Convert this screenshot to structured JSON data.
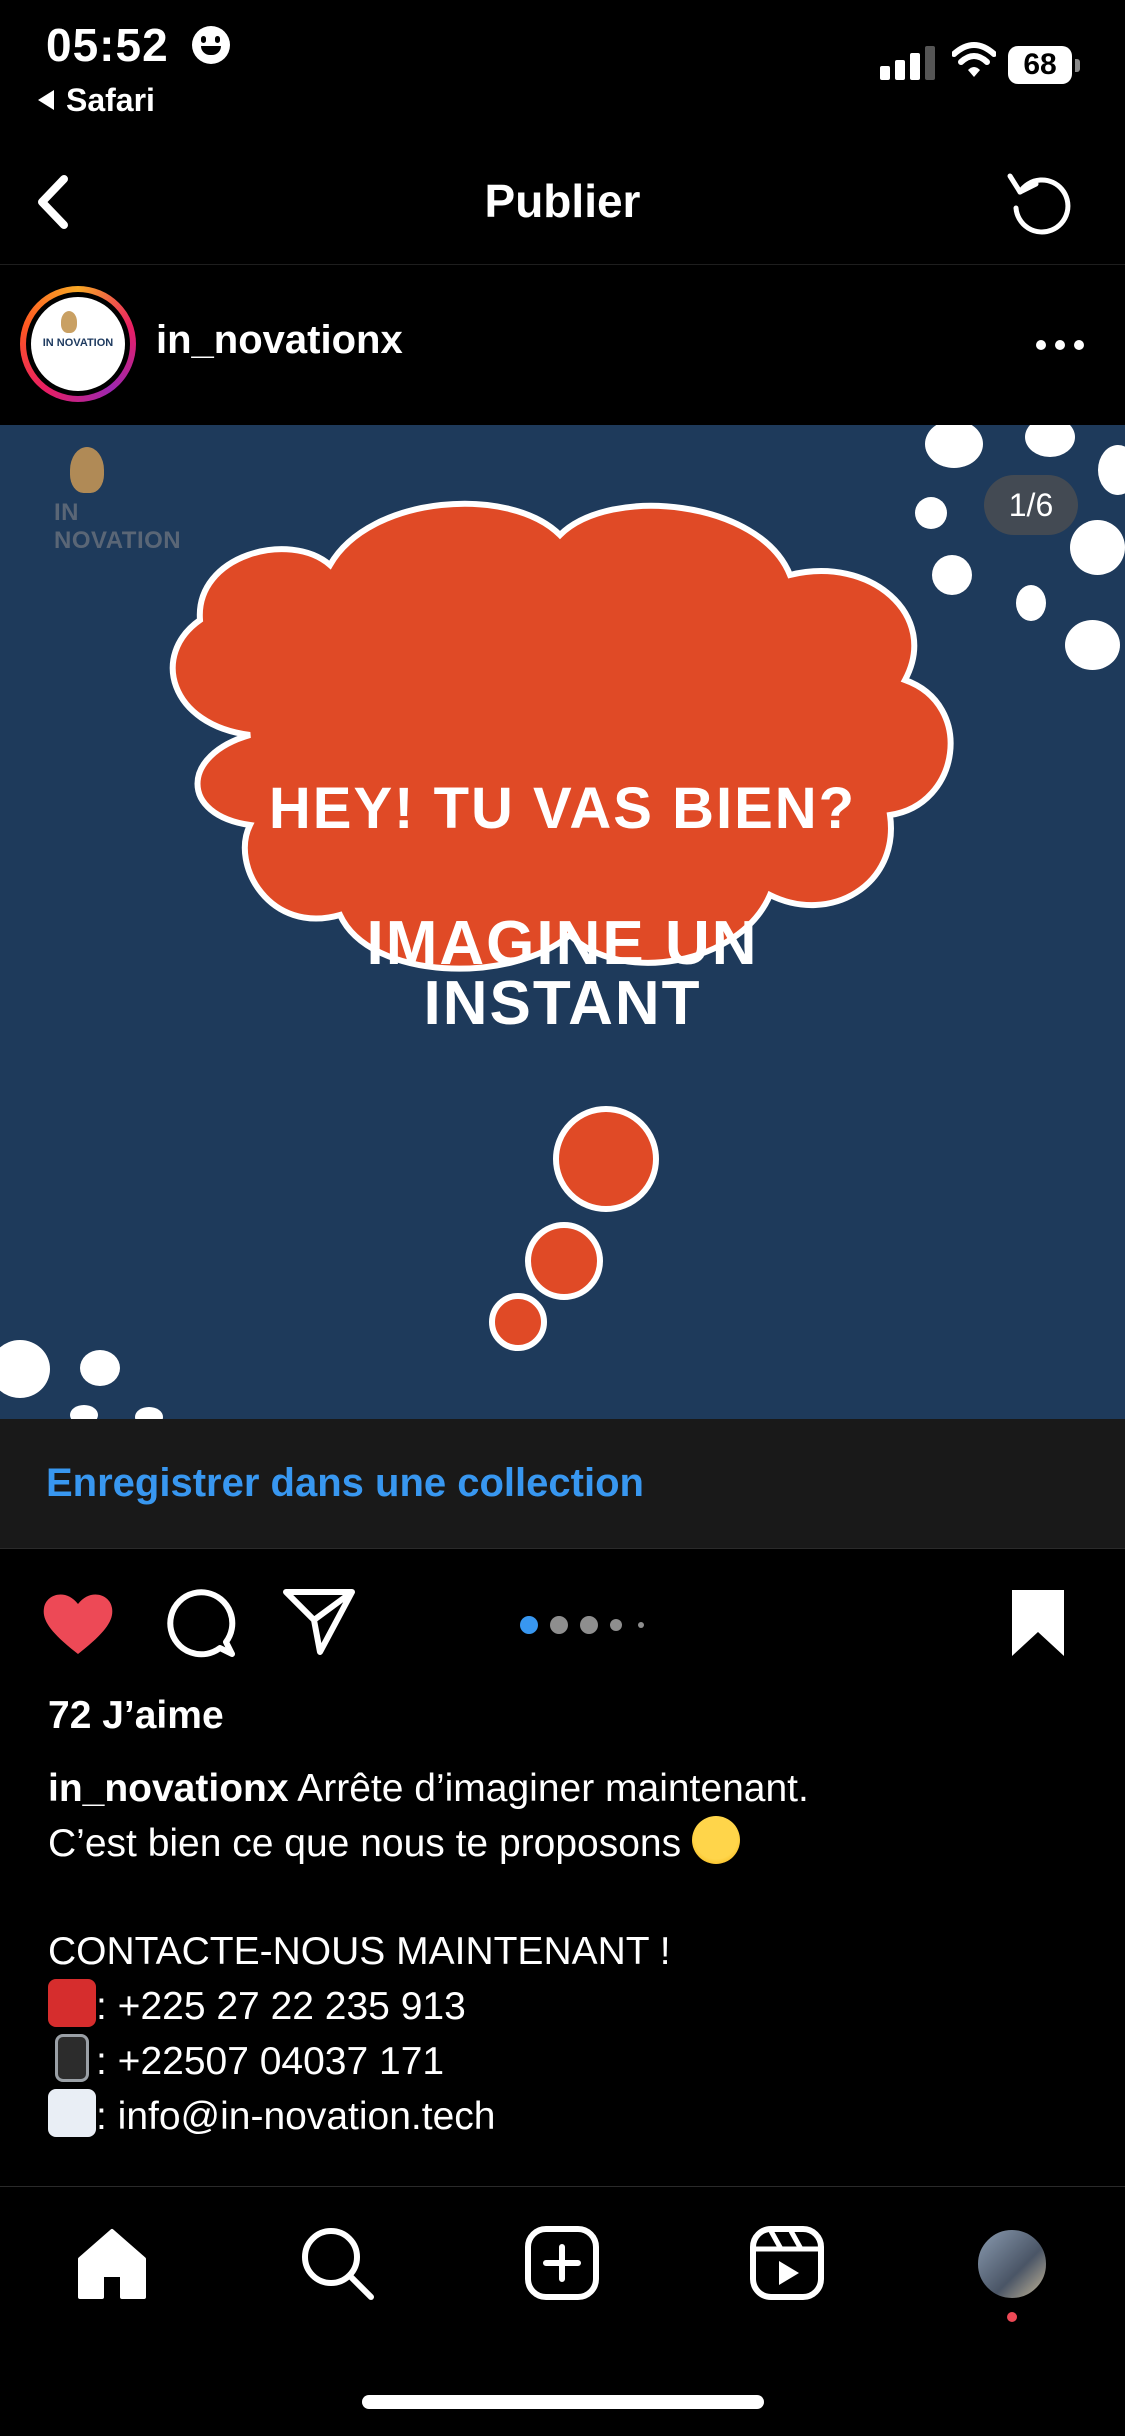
{
  "status_bar": {
    "time": "05:52",
    "back_app": "Safari",
    "battery": "68"
  },
  "header": {
    "title": "Publier"
  },
  "post": {
    "username": "in_novationx",
    "image": {
      "brand": "IN NOVATION",
      "page_indicator": "1/6",
      "line1": "HEY! TU VAS BIEN?",
      "line2": "IMAGINE UN",
      "line3": "INSTANT",
      "colors": {
        "background": "#1e3a5b",
        "cloud": "#e04a26",
        "blobs": "#ffffff"
      }
    },
    "save_collection": "Enregistrer dans une collection",
    "carousel": {
      "current": 1,
      "total": 6
    },
    "likes": "72 J’aime",
    "caption": {
      "username": "in_novationx",
      "line1": "Arrête d’imaginer maintenant.",
      "line2": "C’est bien ce que nous te proposons",
      "contact_heading": "CONTACTE-NOUS MAINTENANT !",
      "phone_fixed": ": +225 27 22 235 913",
      "phone_mobile": ": +22507 04037 171",
      "email": ": info@in-novation.tech"
    }
  },
  "tab_bar": {
    "items": [
      "home-icon",
      "search-icon",
      "create-icon",
      "reels-icon",
      "profile-avatar"
    ]
  },
  "colors": {
    "accent": "#3897f0",
    "like": "#ed4956"
  }
}
